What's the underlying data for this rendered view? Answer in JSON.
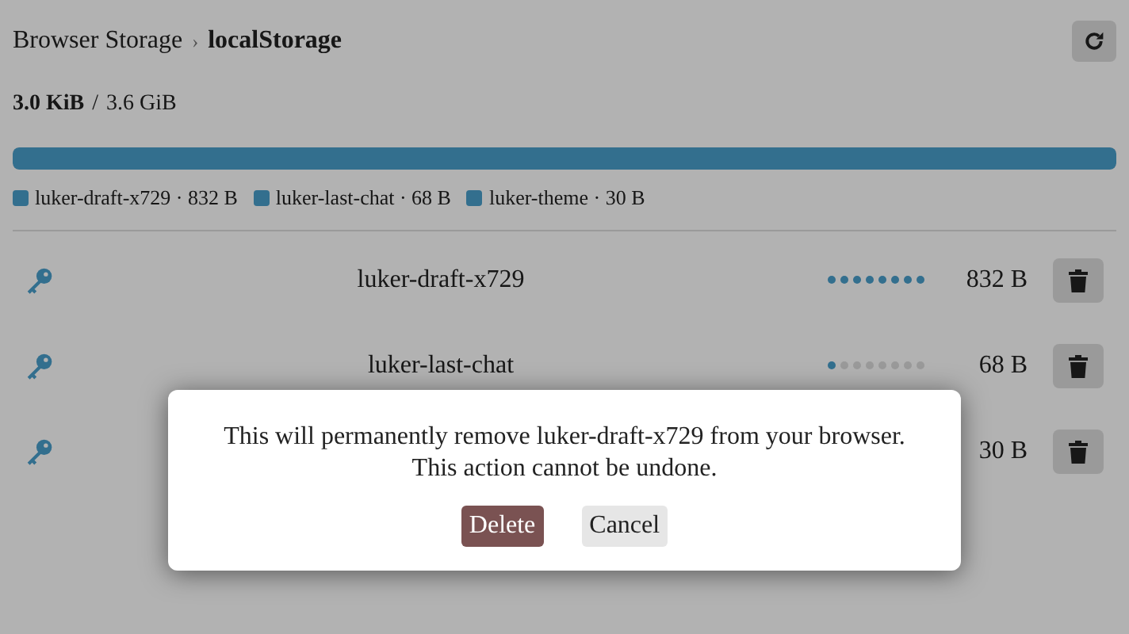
{
  "breadcrumb": [
    {
      "label": "Browser Storage",
      "current": false
    },
    {
      "label": "localStorage",
      "current": true
    }
  ],
  "breadcrumb_separator": "›",
  "usage": {
    "used": "3.0 KiB",
    "separator": "/",
    "total": "3.6 GiB"
  },
  "usage_bar": {
    "level": 1
  },
  "legend": [
    {
      "label": "luker-draft-x729 · 832 B"
    },
    {
      "label": "luker-last-chat · 68 B"
    },
    {
      "label": "luker-theme · 30 B"
    }
  ],
  "entries": [
    {
      "name": "luker-draft-x729",
      "size": "832 B",
      "dots": [
        {
          "on": true
        },
        {
          "on": true
        },
        {
          "on": true
        },
        {
          "on": true
        },
        {
          "on": true
        },
        {
          "on": true
        },
        {
          "on": true
        },
        {
          "on": true
        }
      ]
    },
    {
      "name": "luker-last-chat",
      "size": "68 B",
      "dots": [
        {
          "on": true
        },
        {
          "on": false
        },
        {
          "on": false
        },
        {
          "on": false
        },
        {
          "on": false
        },
        {
          "on": false
        },
        {
          "on": false
        },
        {
          "on": false
        }
      ]
    },
    {
      "size": "30 B"
    }
  ],
  "dialog": {
    "message": "This will permanently remove luker-draft-x729 from your browser. This action cannot be undone.",
    "buttons": [
      {
        "label": "Delete",
        "kind": "danger"
      },
      {
        "label": "Cancel",
        "kind": "secondary"
      }
    ]
  }
}
